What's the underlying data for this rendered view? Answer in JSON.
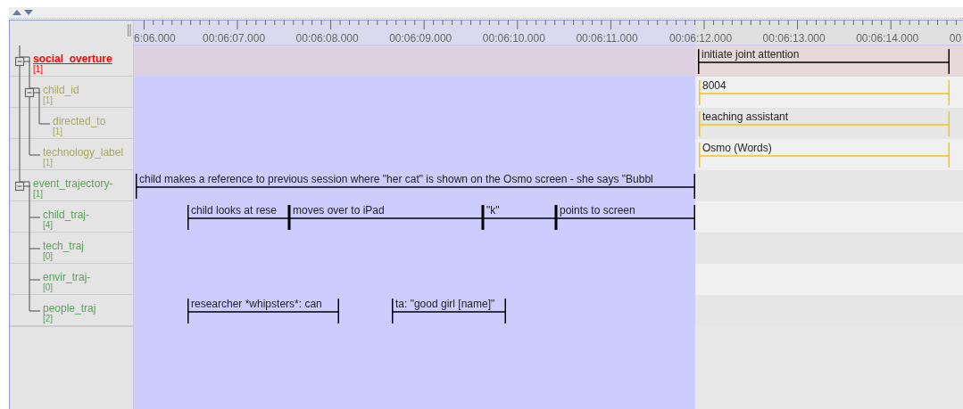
{
  "ruler": {
    "labels": [
      "6:06.000",
      "00:06:07.000",
      "00:06:08.000",
      "00:06:09.000",
      "00:06:10.000",
      "00:06:11.000",
      "00:06:12.000",
      "00:06:13.000",
      "00:06:14.000",
      "00"
    ]
  },
  "tiers": [
    {
      "name": "social_overture",
      "count": "[1]",
      "color": "#ff0000",
      "active": true,
      "kind": "time",
      "annotations": [
        {
          "text": "initiate joint attention"
        }
      ],
      "children": [
        {
          "name": "child_id",
          "count": "[1]",
          "color": "#a8a860",
          "active": false,
          "kind": "association",
          "annotations": [
            {
              "text": "8004"
            }
          ],
          "children": [
            {
              "name": "directed_to",
              "count": "[1]",
              "color": "#a8a860",
              "active": false,
              "kind": "association",
              "annotations": [
                {
                  "text": "teaching assistant"
                }
              ]
            }
          ]
        },
        {
          "name": "technology_label",
          "count": "[1]",
          "color": "#a8a860",
          "active": false,
          "kind": "association",
          "annotations": [
            {
              "text": "Osmo (Words)"
            }
          ]
        }
      ]
    },
    {
      "name": "event_trajectory-",
      "count": "[1]",
      "color": "#5aa05a",
      "active": false,
      "kind": "time",
      "annotations": [
        {
          "text": "child makes a reference to previous session where \"her cat\" is shown on the Osmo screen - she says \"Bubbl"
        }
      ],
      "children": [
        {
          "name": "child_traj-",
          "count": "[4]",
          "color": "#5aa05a",
          "active": false,
          "kind": "time",
          "annotations": [
            {
              "text": "child looks at rese"
            },
            {
              "text": "moves over to iPad"
            },
            {
              "text": "\"k\""
            },
            {
              "text": "points to screen"
            }
          ]
        },
        {
          "name": "tech_traj",
          "count": "[0]",
          "color": "#5aa05a",
          "active": false
        },
        {
          "name": "envir_traj-",
          "count": "[0]",
          "color": "#5aa05a",
          "active": false
        },
        {
          "name": "people_traj",
          "count": "[2]",
          "color": "#5aa05a",
          "active": false,
          "kind": "time",
          "annotations": [
            {
              "text": "researcher *whipsters*: can"
            },
            {
              "text": "ta: \"good girl [name]\""
            }
          ]
        }
      ]
    }
  ]
}
